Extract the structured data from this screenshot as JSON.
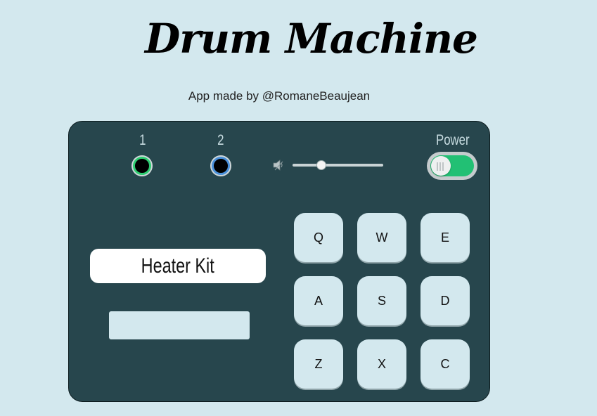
{
  "header": {
    "title": "Drum Machine",
    "subtitle": "App made by @RomaneBeaujean"
  },
  "banks": [
    {
      "label": "1",
      "color": "#2ecc71"
    },
    {
      "label": "2",
      "color": "#4a90d9"
    }
  ],
  "volume": {
    "icon": "speaker-icon",
    "value": 0.32
  },
  "power": {
    "label": "Power",
    "on": true,
    "color": "#22c074"
  },
  "display": {
    "kit_name": "Heater Kit",
    "sound_name": ""
  },
  "pads": [
    "Q",
    "W",
    "E",
    "A",
    "S",
    "D",
    "Z",
    "X",
    "C"
  ],
  "colors": {
    "background": "#d3e8ee",
    "machine": "#27464d",
    "pad": "#d3e8ee"
  }
}
